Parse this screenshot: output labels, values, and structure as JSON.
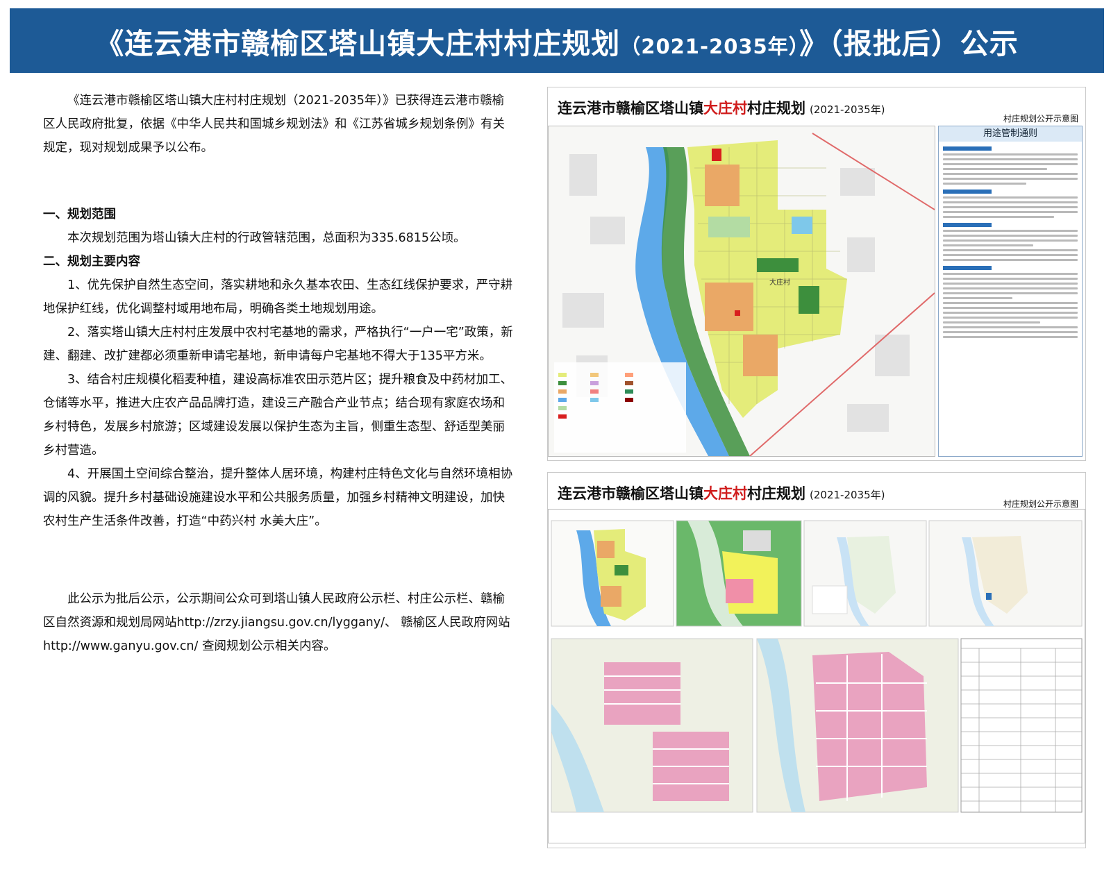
{
  "header": {
    "title_main": "《连云港市赣榆区塔山镇大庄村村庄规划",
    "title_year": "（2021-2035年）",
    "title_tail": "》（报批后）公示",
    "bg_color": "#1d5a96"
  },
  "body": {
    "intro": "《连云港市赣榆区塔山镇大庄村村庄规划（2021-2035年）》已获得连云港市赣榆区人民政府批复，依据《中华人民共和国城乡规划法》和《江苏省城乡规划条例》有关规定，现对规划成果予以公布。",
    "h1": "一、规划范围",
    "scope": "本次规划范围为塔山镇大庄村的行政管辖范围，总面积为335.6815公顷。",
    "h2": "二、规划主要内容",
    "item1": "1、优先保护自然生态空间，落实耕地和永久基本农田、生态红线保护要求，严守耕地保护红线，优化调整村域用地布局，明确各类土地规划用途。",
    "item2": "2、落实塔山镇大庄村村庄发展中农村宅基地的需求，严格执行“一户一宅”政策，新建、翻建、改扩建都必须重新申请宅基地，新申请每户宅基地不得大于135平方米。",
    "item3": "3、结合村庄规模化稻麦种植，建设高标准农田示范片区；提升粮食及中药材加工、仓储等水平，推进大庄农产品品牌打造，建设三产融合产业节点；结合现有家庭农场和乡村特色，发展乡村旅游；区域建设发展以保护生态为主旨，侧重生态型、舒适型美丽乡村营造。",
    "item4": "4、开展国土空间综合整治，提升整体人居环境，构建村庄特色文化与自然环境相协调的风貌。提升乡村基础设施建设水平和公共服务质量，加强乡村精神文明建设，加快农村生产生活条件改善，打造“中药兴村 水美大庄”。",
    "notice": "此公示为批后公示，公示期间公众可到塔山镇人民政府公示栏、村庄公示栏、赣榆区自然资源和规划局网站http://zrzy.jiangsu.gov.cn/lyggany/、 赣榆区人民政府网站http://www.ganyu.gov.cn/ 查阅规划公示相关内容。"
  },
  "panel1": {
    "title_a": "连云港市赣榆区塔山镇",
    "title_red": "大庄村",
    "title_b": "村庄规划",
    "title_year": "(2021-2035年)",
    "subtitle": "村庄规划公开示意图",
    "rules_heading": "用途管制通则",
    "map_label": "大庄村"
  },
  "panel2": {
    "title_a": "连云港市赣榆区塔山镇",
    "title_red": "大庄村",
    "title_b": "村庄规划",
    "title_year": "(2021-2035年)",
    "subtitle": "村庄规划公开示意图"
  }
}
